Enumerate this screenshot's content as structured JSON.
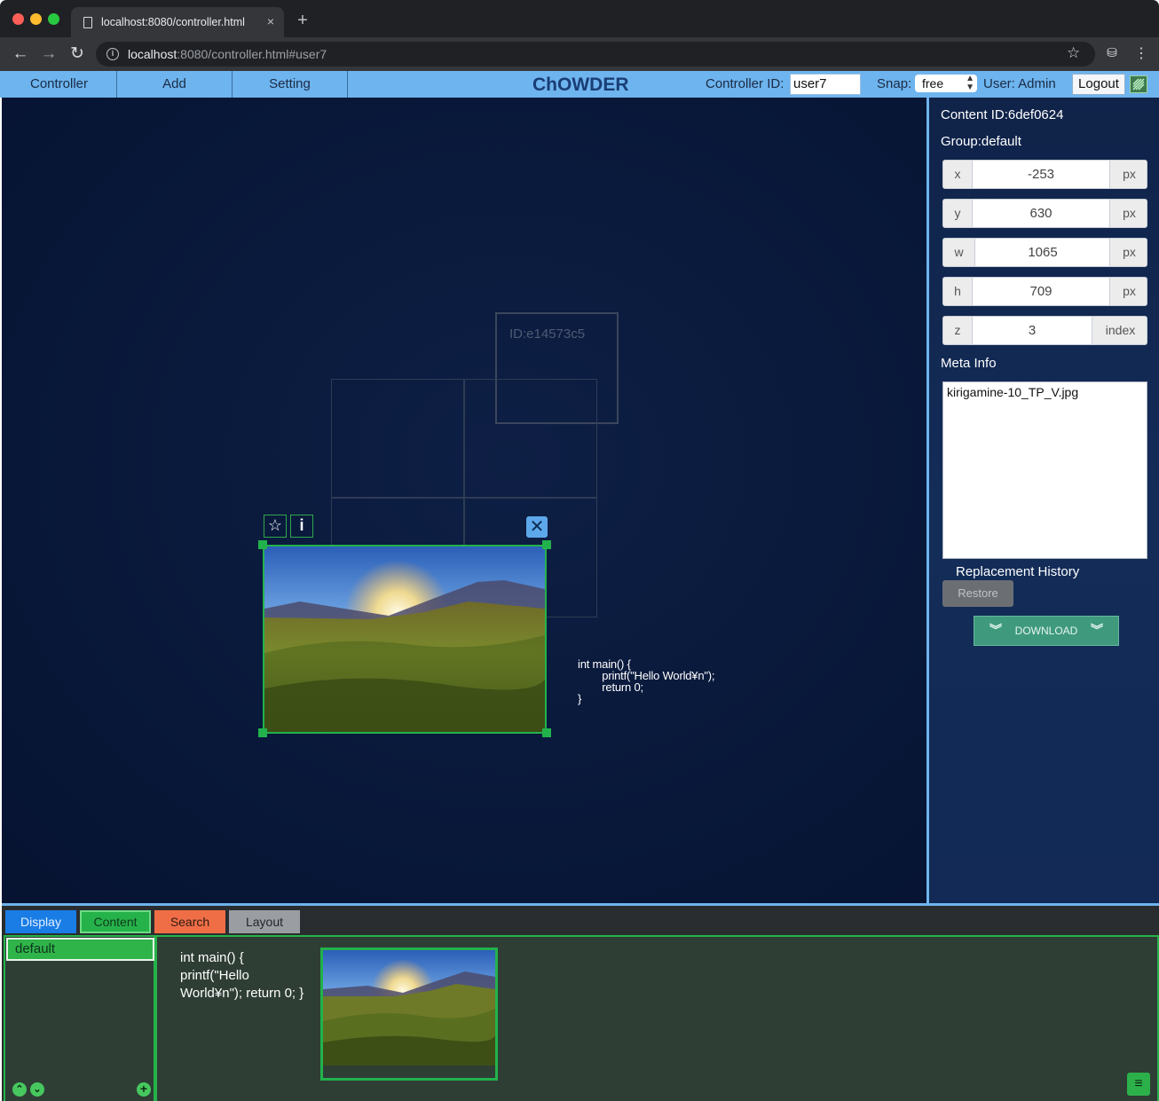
{
  "browser": {
    "tab_title": "localhost:8080/controller.html",
    "url_host": "localhost",
    "url_rest": ":8080/controller.html#user7",
    "new_tab": "+",
    "tab_close": "×"
  },
  "menu": {
    "items": [
      "Controller",
      "Add",
      "Setting"
    ],
    "app_title": "ChOWDER",
    "controller_id_label": "Controller ID:",
    "controller_id_value": "user7",
    "snap_label": "Snap:",
    "snap_value": "free",
    "user_label": "User: Admin",
    "logout_label": "Logout"
  },
  "canvas": {
    "display_id": "ID:e14573c5",
    "code_content": "int main() {\n        printf(\"Hello World¥n\");\n        return 0;\n}"
  },
  "properties": {
    "content_id": "Content ID:6def0624",
    "group": "Group:default",
    "rows": [
      {
        "key": "x",
        "value": "-253",
        "unit": "px"
      },
      {
        "key": "y",
        "value": "630",
        "unit": "px"
      },
      {
        "key": "w",
        "value": "1065",
        "unit": "px"
      },
      {
        "key": "h",
        "value": "709",
        "unit": "px"
      },
      {
        "key": "z",
        "value": "3",
        "unit": "index"
      }
    ],
    "meta_label": "Meta Info",
    "meta_value": "kirigamine-10_TP_V.jpg",
    "replacement_label": "Replacement History",
    "restore_label": "Restore",
    "download_label": "DOWNLOAD"
  },
  "bottom": {
    "tabs": [
      "Display",
      "Content",
      "Search",
      "Layout"
    ],
    "groups": [
      "default"
    ],
    "text_thumb": "int main() { printf(\"Hello World¥n\"); return 0; }"
  },
  "colors": {
    "menu_bar": "#6eb4ee",
    "selection_green": "#22b24c",
    "canvas_bg": "#0a1a3c",
    "tab_display": "#1a7de6",
    "tab_content": "#26b24a",
    "tab_search": "#f06e46",
    "tab_layout": "#9a9ea3"
  }
}
